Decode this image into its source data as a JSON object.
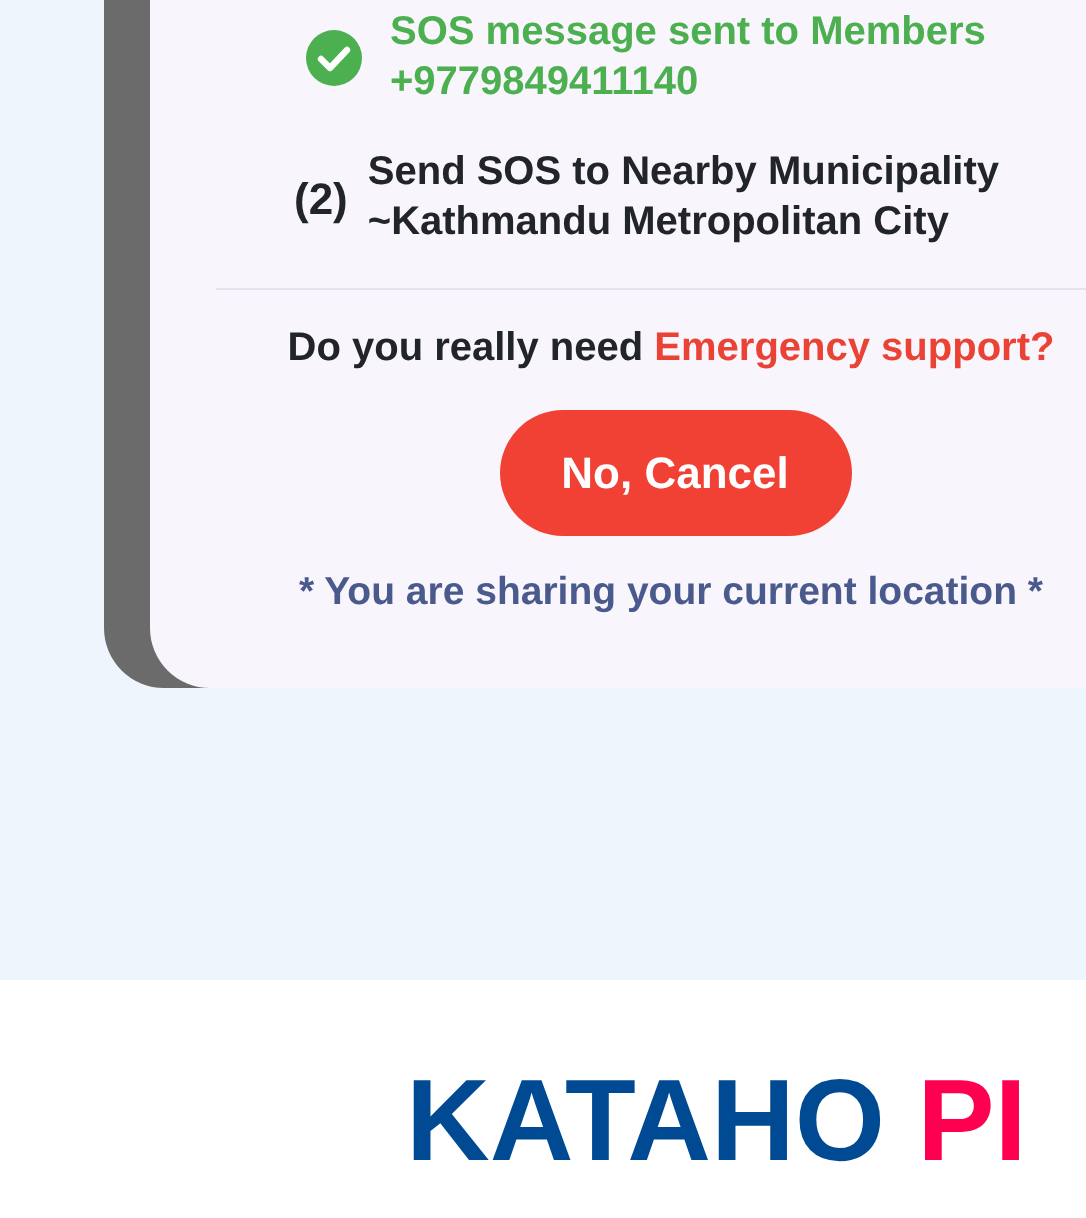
{
  "dialog": {
    "items": [
      {
        "kind": "done",
        "lines": [
          "SOS message sent to Members",
          "+9779849411140"
        ]
      },
      {
        "kind": "step",
        "number": "(2)",
        "lines": [
          "Send SOS to Nearby Municipality",
          "~Kathmandu Metropolitan City"
        ]
      }
    ],
    "question": {
      "text": "Do you really need",
      "highlight": "Emergency support?"
    },
    "cancel_button": "No, Cancel",
    "note": "* You are sharing your current location *"
  },
  "logo": {
    "part_1": "KATAHO",
    "part_2": "PI"
  }
}
